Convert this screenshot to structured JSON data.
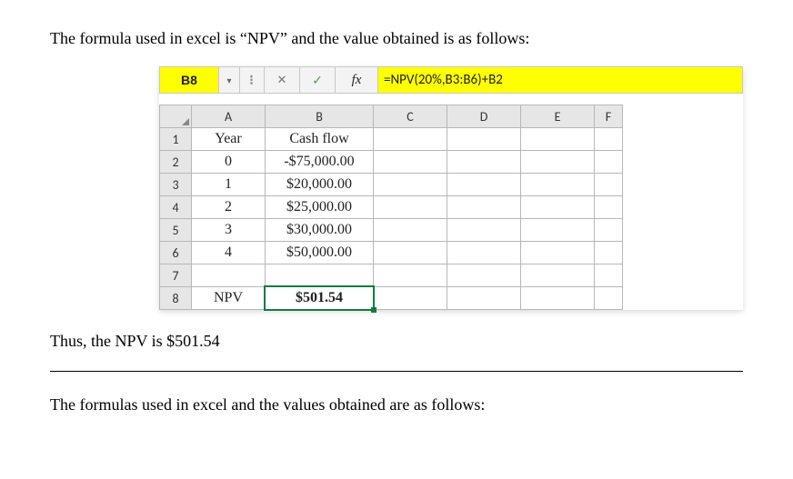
{
  "text": {
    "intro": "The formula used in excel is “NPV” and the value obtained is as follows:",
    "outro": "Thus, the NPV is $501.54",
    "footer": "The formulas used in excel and the values obtained are as follows:"
  },
  "formula_bar": {
    "cell_ref": "B8",
    "dropdown_glyph": "▾",
    "menu_glyph": "⁝",
    "cancel_glyph": "✕",
    "enter_glyph": "✓",
    "fx_glyph": "fx",
    "formula": "=NPV(20%,B3:B6)+B2"
  },
  "columns": {
    "A": "A",
    "B": "B",
    "C": "C",
    "D": "D",
    "E": "E",
    "F": "F"
  },
  "rows": {
    "r1": {
      "n": "1",
      "A": "Year",
      "B": "Cash flow"
    },
    "r2": {
      "n": "2",
      "A": "0",
      "B": "-$75,000.00"
    },
    "r3": {
      "n": "3",
      "A": "1",
      "B": "$20,000.00"
    },
    "r4": {
      "n": "4",
      "A": "2",
      "B": "$25,000.00"
    },
    "r5": {
      "n": "5",
      "A": "3",
      "B": "$30,000.00"
    },
    "r6": {
      "n": "6",
      "A": "4",
      "B": "$50,000.00"
    },
    "r7": {
      "n": "7",
      "A": "",
      "B": ""
    },
    "r8": {
      "n": "8",
      "A": "NPV",
      "B": "$501.54"
    }
  }
}
